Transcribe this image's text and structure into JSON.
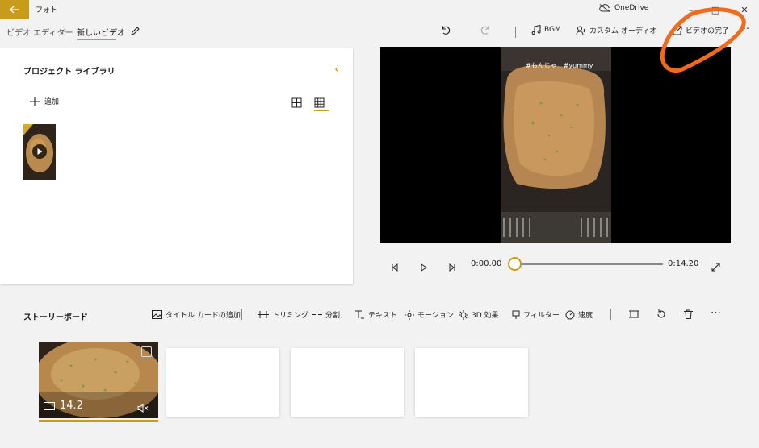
{
  "titlebar": {
    "app_title": "フォト",
    "onedrive_label": "OneDrive"
  },
  "toolbar": {
    "breadcrumb_parent": "ビデオ エディター",
    "breadcrumb_current": "新しいビデオ",
    "bgm_label": "BGM",
    "custom_audio_label": "カスタム オーディオ",
    "finish_video_label": "ビデオの完了"
  },
  "library": {
    "title": "プロジェクト ライブラリ",
    "add_label": "追加"
  },
  "player": {
    "caption": "#もんじゃ　#yummy",
    "current_time": "0:00.00",
    "total_time": "0:14.20",
    "progress": 0
  },
  "storyboard": {
    "title": "ストーリーボード",
    "actions": [
      "タイトル カードの追加",
      "トリミング",
      "分割",
      "テキスト",
      "モーション",
      "3D 効果",
      "フィルター",
      "速度"
    ],
    "clips": [
      {
        "duration": "14.2"
      }
    ]
  },
  "colors": {
    "accent": "#c89b1d",
    "annotation": "#f26a1b"
  }
}
